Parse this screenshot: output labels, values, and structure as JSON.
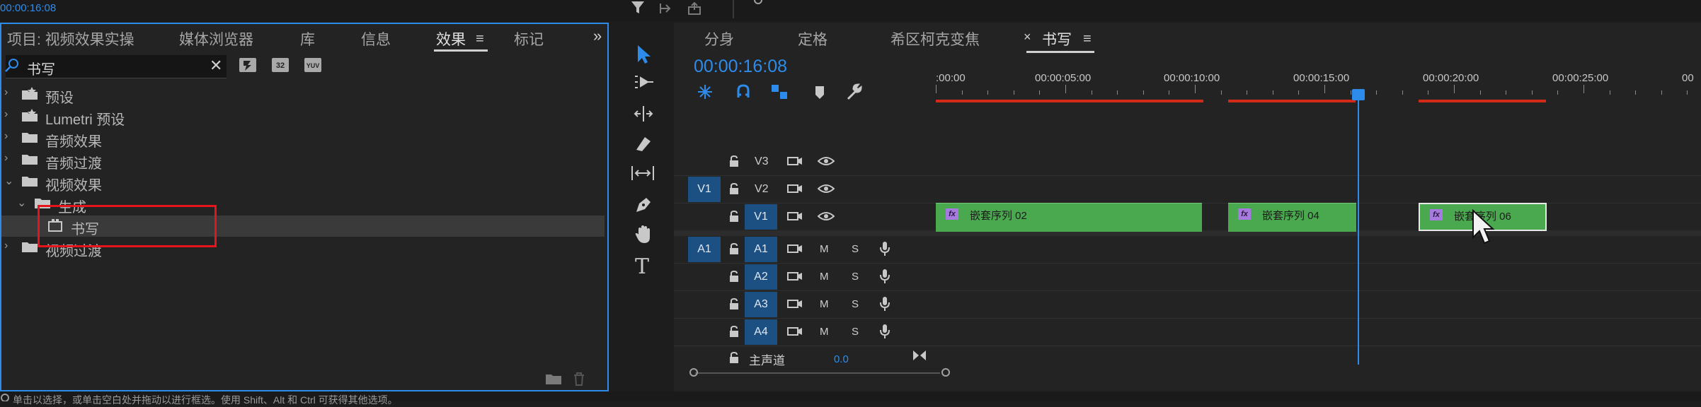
{
  "top_bar": {
    "timecode": "00:00:16:08"
  },
  "effects_panel": {
    "tabs": [
      {
        "label": "项目: 视频效果实操"
      },
      {
        "label": "媒体浏览器"
      },
      {
        "label": "库"
      },
      {
        "label": "信息"
      },
      {
        "label": "效果",
        "active": true
      },
      {
        "label": "标记"
      }
    ],
    "search": {
      "value": "书写",
      "clear": "✕"
    },
    "badges": [
      "",
      "32",
      "YUV"
    ],
    "tree": [
      {
        "label": "预设",
        "expanded": false,
        "preset": true
      },
      {
        "label": "Lumetri 预设",
        "expanded": false,
        "preset": true
      },
      {
        "label": "音频效果",
        "expanded": false
      },
      {
        "label": "音频过渡",
        "expanded": false
      },
      {
        "label": "视频效果",
        "expanded": true
      },
      {
        "label": "生成",
        "expanded": true
      },
      {
        "label": "书写",
        "selected": true
      },
      {
        "label": "视频过渡",
        "expanded": false
      }
    ]
  },
  "timeline": {
    "tabs": [
      {
        "label": "分身"
      },
      {
        "label": "定格"
      },
      {
        "label": "希区柯克变焦"
      },
      {
        "label": "书写",
        "active": true,
        "close": "×"
      }
    ],
    "timecode": "00:00:16:08",
    "ruler_labels": [
      ":00:00",
      "00:00:05:00",
      "00:00:10:00",
      "00:00:15:00",
      "00:00:20:00",
      "00:00:25:00",
      "00"
    ],
    "video_tracks": [
      {
        "name": "V3"
      },
      {
        "name": "V2",
        "source_toggle": "V1"
      },
      {
        "name": "V1"
      }
    ],
    "audio_tracks": [
      {
        "name": "A1",
        "source_toggle": "A1",
        "mute": "M",
        "solo": "S"
      },
      {
        "name": "A2",
        "mute": "M",
        "solo": "S"
      },
      {
        "name": "A3",
        "mute": "M",
        "solo": "S"
      },
      {
        "name": "A4",
        "mute": "M",
        "solo": "S"
      }
    ],
    "master": {
      "label": "主声道",
      "value": "0.0"
    },
    "clips": [
      {
        "label": "嵌套序列 02",
        "fx": "fx"
      },
      {
        "label": "嵌套序列 04",
        "fx": "fx"
      },
      {
        "label": "嵌套序列 06",
        "fx": "fx"
      }
    ]
  },
  "status_bar": {
    "text": "单击以选择，或单击空白处并拖动以进行框选。使用 Shift、Alt 和 Ctrl 可获得其他选项。"
  },
  "colors": {
    "accent": "#2d8ceb",
    "clip_green": "#4aa84e",
    "highlight_red": "#e8141c",
    "render_bar_red": "#d22a16"
  }
}
